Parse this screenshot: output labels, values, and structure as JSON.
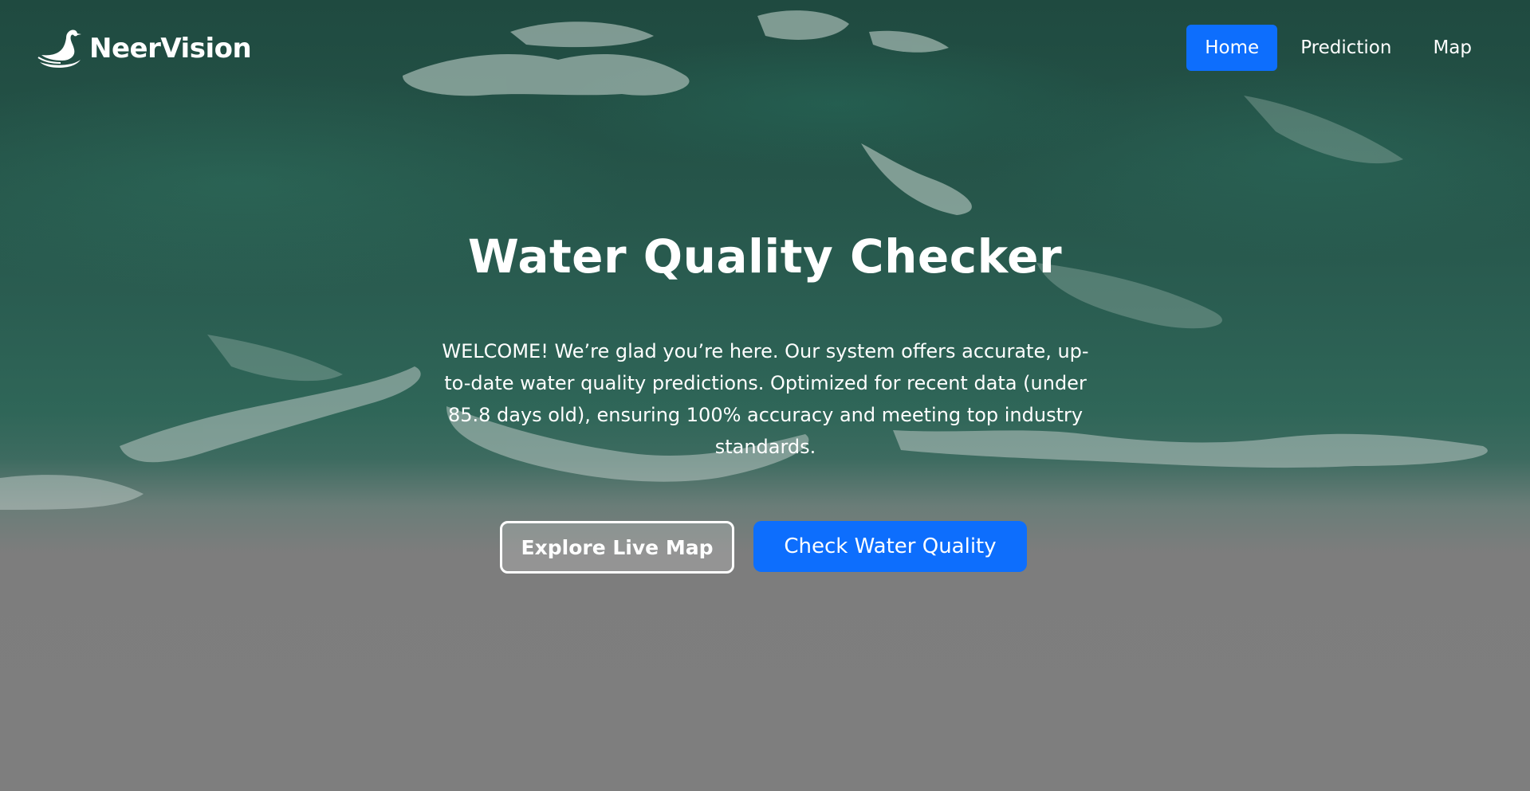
{
  "brand": {
    "name": "NeerVision",
    "logo_icon": "swan-icon"
  },
  "nav": {
    "items": [
      {
        "label": "Home",
        "active": true
      },
      {
        "label": "Prediction",
        "active": false
      },
      {
        "label": "Map",
        "active": false
      }
    ]
  },
  "hero": {
    "title": "Water Quality Checker",
    "text": "WELCOME! We’re glad you’re here. Our system offers accurate, up-to-date water quality predictions. Optimized for recent data (under 85.8 days old), ensuring 100% accuracy and meeting top industry standards.",
    "buttons": {
      "explore_label": "Explore Live Map",
      "check_label": "Check Water Quality"
    }
  },
  "colors": {
    "accent": "#0d6efd",
    "ocean_dark": "#1f4a40",
    "sand": "#7d7d7d",
    "text": "#ffffff"
  }
}
